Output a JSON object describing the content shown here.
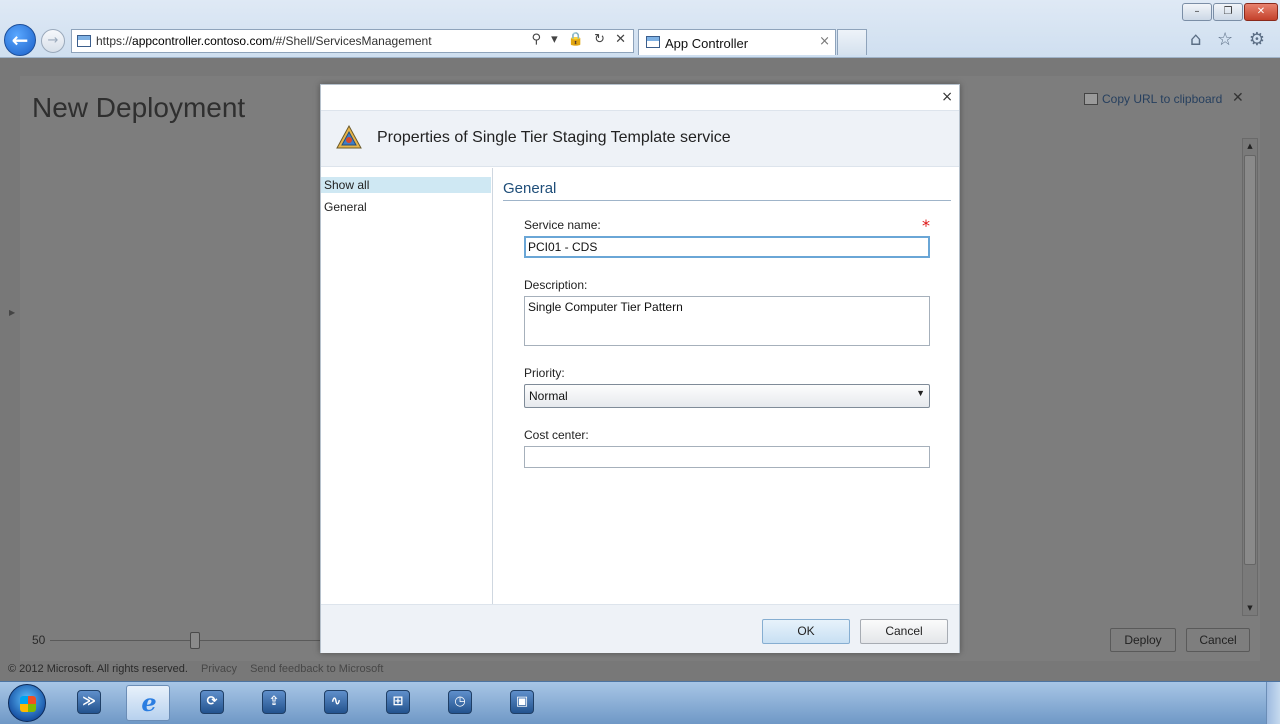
{
  "browser": {
    "url_prefix": "https://",
    "url_host": "appcontroller.contoso.com",
    "url_path": "/#/Shell/ServicesManagement",
    "tab_title": "App Controller",
    "tab_close": "×",
    "back_icon": "back-arrow-icon",
    "forward_icon": "forward-arrow-icon",
    "address_icons": "⚲ ▾ 🔒 ↻ ✕",
    "toolbar_icons": "⌂ ☆ ⚙",
    "window": {
      "minimize": "–",
      "maximize": "❐",
      "close": "✕"
    }
  },
  "app": {
    "title": "New Deployment",
    "copy_url_label": "Copy URL to clipboard",
    "copy_url_close": "✕",
    "zoom_value": "50",
    "zoom_level": 0.55,
    "deploy_label": "Deploy",
    "cancel_label": "Cancel",
    "footer": {
      "copyright": "© 2012 Microsoft. All rights reserved.",
      "privacy": "Privacy",
      "feedback": "Send feedback to Microsoft"
    }
  },
  "dialog": {
    "close": "×",
    "title": "Properties of Single Tier Staging Template service",
    "nav": [
      "Show all",
      "General"
    ],
    "section_title": "General",
    "fields": {
      "service_name_label": "Service name:",
      "service_name_value": "PCI01 - CDS",
      "required_marker": "*",
      "description_label": "Description:",
      "description_value": "Single Computer Tier Pattern",
      "priority_label": "Priority:",
      "priority_value": "Normal",
      "cost_center_label": "Cost center:",
      "cost_center_value": ""
    },
    "ok_label": "OK",
    "cancel_label": "Cancel"
  },
  "taskbar": {
    "items": [
      "start-orb",
      "powershell-icon",
      "internet-explorer-icon",
      "service-manager-icon",
      "file-transfer-icon",
      "performance-monitor-icon",
      "network-icon",
      "scheduler-icon",
      "remote-desktop-icon"
    ],
    "ie_glyph": "e",
    "ps_glyph": "≫",
    "glyphs": [
      "⟳",
      "⇪",
      "∿",
      "⊞",
      "◷",
      "▣"
    ]
  },
  "colors": {
    "accent": "#1f4e79",
    "selection": "#cfe8f3",
    "required": "#dd1111",
    "overlay": "#787878"
  }
}
